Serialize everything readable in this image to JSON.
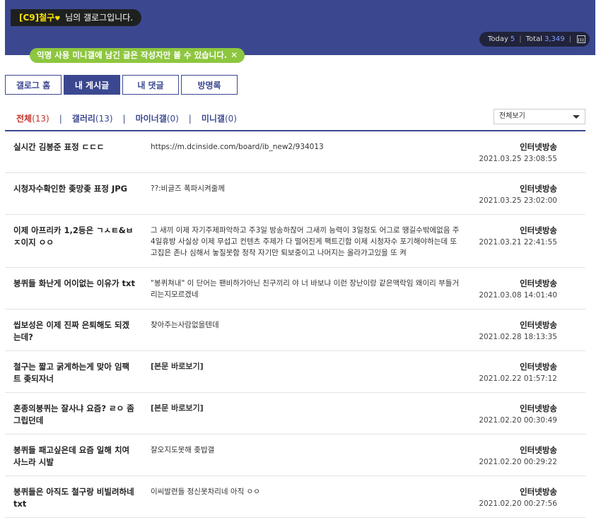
{
  "header": {
    "owner_name": "[C9]철구",
    "owner_heart": "♥",
    "owner_suffix": " 님의 갤로그입니다.",
    "today_label": "Today",
    "today_value": "5",
    "total_label": "Total",
    "total_value": "3,349"
  },
  "notice": {
    "text": "익명 사용 미니갤에 남긴 글은 작성자만 볼 수 있습니다.",
    "close": "✕"
  },
  "tabs": [
    {
      "label": "갤로그 홈"
    },
    {
      "label": "내 게시글"
    },
    {
      "label": "내 댓글"
    },
    {
      "label": "방명록"
    }
  ],
  "filters": [
    {
      "label": "전체",
      "count": "(13)"
    },
    {
      "label": "갤러리",
      "count": "(13)"
    },
    {
      "label": "마이너갤",
      "count": "(0)"
    },
    {
      "label": "미니갤",
      "count": "(0)"
    }
  ],
  "filter_separator": "|",
  "select": {
    "value": "전체보기"
  },
  "posts": [
    {
      "title": "실시간 김봉준 표정 ㄷㄷㄷ",
      "body": "https://m.dcinside.com/board/ib_new2/934013",
      "author": "인터넷방송",
      "date": "2021.03.25 23:08:55"
    },
    {
      "title": "시청자수확인한 좆망좆 표정 JPG",
      "body": "??:비글즈 폭파시켜줄께",
      "author": "인터넷방송",
      "date": "2021.03.25 23:02:00"
    },
    {
      "title": "이제 아프리카 1,2등은 ㄱㅅㅌ&ㅂㅈ이지 ㅇㅇ",
      "body": "그 새끼 이제 자기주제파악하고 주3일 방송하잖어 그새끼 능력이 3일정도 어그로 땡길수밖에없음 주4일휴방 사실상 이제 무섭고 컨텐츠 주제가 다 떨어진게 팩트긴함 이제 시청자수 포기해야하는데 또 고집은 존나 심해서 놓질못함 정작 자기만 퇴보중이고 나머지는 올라가고있을 또 켜",
      "author": "인터넷방송",
      "date": "2021.03.21 22:41:55"
    },
    {
      "title": "봉퀴들 화난게 어이없는 이유가 txt",
      "body": "\"봉퀴쳐내\" 이 단어는 팬비하가아닌 친구끼리 야 너 바보냐 이런 장난이랑 같은맥락임 왜이리 부들거리는지모르겠네",
      "author": "인터넷방송",
      "date": "2021.03.08 14:01:40"
    },
    {
      "title": "씹보성은 이제 진짜 은퇴해도 되겠는데?",
      "body": "찾아주는사람없을텐데",
      "author": "인터넷방송",
      "date": "2021.02.28 18:13:35"
    },
    {
      "title": "철구는 짧고 굵게하는게 맞아 임팩트 좆되자너",
      "body": "[본문 바로보기]",
      "author": "인터넷방송",
      "date": "2021.02.22 01:57:12",
      "link": true
    },
    {
      "title": "혼종의봉퀴는 잘사냐 요즘? ㄹㅇ 좀 그립던데",
      "body": "[본문 바로보기]",
      "author": "인터넷방송",
      "date": "2021.02.20 00:30:49",
      "link": true
    },
    {
      "title": "봉퀴들 패고싶은데 요즘 일해 치여사느라 시발",
      "body": "잘오지도못해 좆밥갤",
      "author": "인터넷방송",
      "date": "2021.02.20 00:29:22"
    },
    {
      "title": "봉퀴들은 아직도 철구랑 비빌려하네 txt",
      "body": "이씨발련들 정신못차리네 아직 ㅇㅇ",
      "author": "인터넷방송",
      "date": "2021.02.20 00:27:56"
    }
  ]
}
